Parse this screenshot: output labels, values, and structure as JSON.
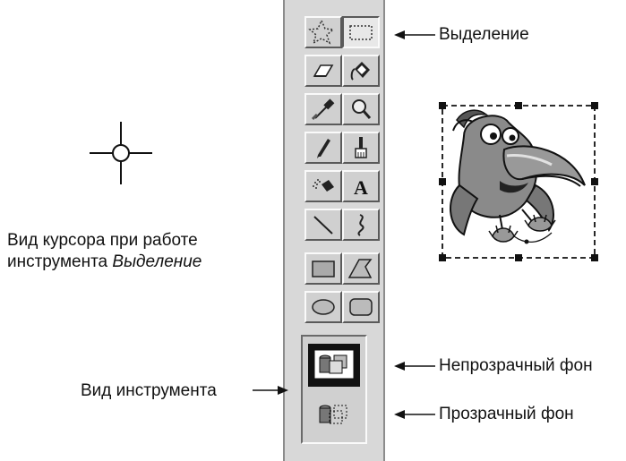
{
  "labels": {
    "selection": "Выделение",
    "opaque_bg": "Непрозрачный фон",
    "transparent_bg": "Прозрачный фон",
    "tool_view": "Вид инструмента",
    "cursor_note_line1": "Вид курсора при работе",
    "cursor_note_line2_prefix": "инструмента ",
    "cursor_note_line2_italic": "Выделение"
  },
  "toolbox": {
    "rows": [
      [
        "free-select-icon",
        "rect-select-icon"
      ],
      [
        "eraser-icon",
        "fill-bucket-icon"
      ],
      [
        "color-picker-icon",
        "magnifier-icon"
      ],
      [
        "pencil-icon",
        "brush-icon"
      ],
      [
        "airbrush-icon",
        "text-icon"
      ],
      [
        "line-icon",
        "curve-icon"
      ],
      [
        "rectangle-icon",
        "polygon-icon"
      ],
      [
        "ellipse-icon",
        "rounded-rect-icon"
      ]
    ],
    "active_tool": "rect-select-icon",
    "text_tool_glyph": "A",
    "selected_option": "opaque"
  },
  "colors": {
    "toolbox_bg": "#d8d8d8",
    "opaque_option_bg": "#111111"
  }
}
